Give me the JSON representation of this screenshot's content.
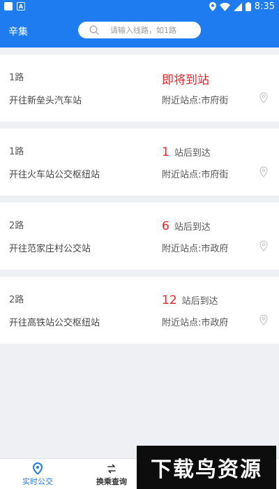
{
  "status_bar": {
    "time": "8:35"
  },
  "header": {
    "city": "辛集",
    "search_placeholder": "请输入线路，如1路"
  },
  "routes": [
    {
      "route": "1路",
      "destination": "开往新垒头汽车站",
      "eta_text": "即将到站",
      "nearby_label": "附近站点:市府街"
    },
    {
      "route": "1路",
      "destination": "开往火车站公交枢纽站",
      "eta_stops": "1",
      "eta_suffix": "站后到达",
      "nearby_label": "附近站点:市府街"
    },
    {
      "route": "2路",
      "destination": "开往范家庄村公交站",
      "eta_stops": "6",
      "eta_suffix": "站后到达",
      "nearby_label": "附近站点:市政府"
    },
    {
      "route": "2路",
      "destination": "开往高铁站公交枢纽站",
      "eta_stops": "12",
      "eta_suffix": "站后到达",
      "nearby_label": "附近站点:市政府"
    }
  ],
  "bottom_nav": {
    "realtime": "实时公交",
    "transfer": "换乘查询"
  },
  "watermark": "下载鸟资源",
  "colors": {
    "primary": "#1f7cf0",
    "eta_red": "#e8252b"
  }
}
